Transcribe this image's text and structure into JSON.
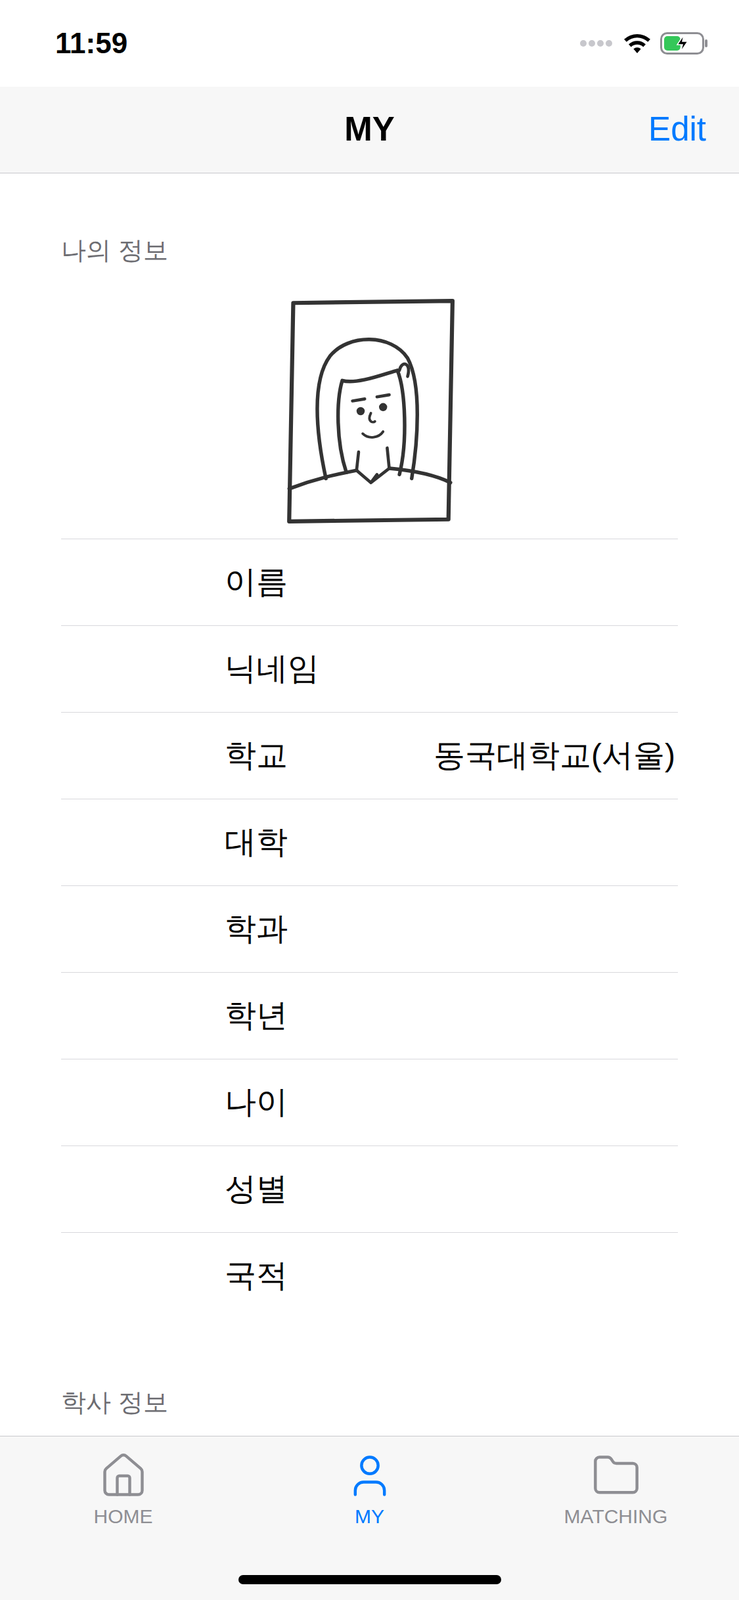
{
  "status_bar": {
    "time": "11:59",
    "battery": {
      "level": 0.45,
      "charging": true
    }
  },
  "nav_bar": {
    "title": "MY",
    "action": "Edit"
  },
  "sections": [
    {
      "title": "나의 정보",
      "photo": true,
      "fields": [
        {
          "label": "이름",
          "value": ""
        },
        {
          "label": "닉네임",
          "value": ""
        },
        {
          "label": "학교",
          "value": "동국대학교(서울)"
        },
        {
          "label": "대학",
          "value": ""
        },
        {
          "label": "학과",
          "value": ""
        },
        {
          "label": "학년",
          "value": ""
        },
        {
          "label": "나이",
          "value": ""
        },
        {
          "label": "성별",
          "value": ""
        },
        {
          "label": "국적",
          "value": ""
        }
      ]
    },
    {
      "title": "학사 정보",
      "photo": false,
      "fields": []
    }
  ],
  "tabs": [
    {
      "label": "HOME",
      "selected": false
    },
    {
      "label": "MY",
      "selected": true
    },
    {
      "label": "MATCHING",
      "selected": false
    }
  ]
}
